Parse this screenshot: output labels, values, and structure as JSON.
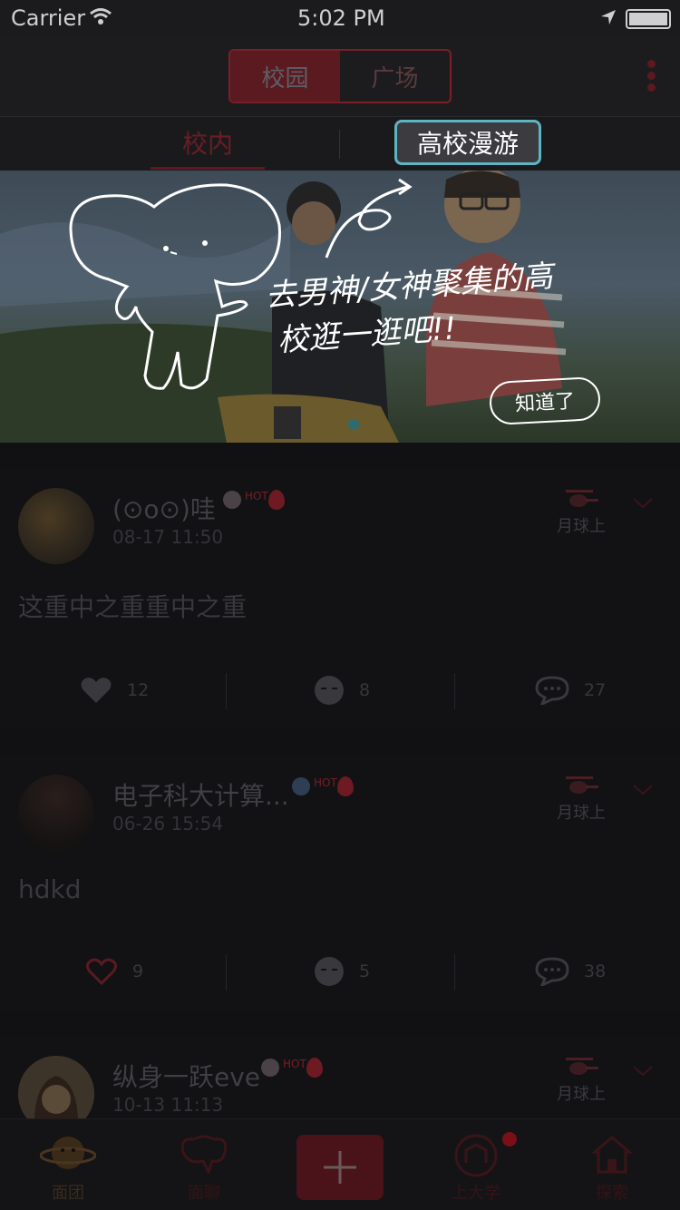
{
  "status_bar": {
    "carrier": "Carrier",
    "time": "5:02 PM"
  },
  "nav": {
    "segments": [
      "校园",
      "广场"
    ],
    "active_segment": 0
  },
  "subtabs": {
    "inner": "校内",
    "roam": "高校漫游"
  },
  "banner": {
    "line1": "去男神/女神聚集的高",
    "line2": "校逛一逛吧!!",
    "got_it": "知道了"
  },
  "posts": [
    {
      "name": "(⊙o⊙)哇",
      "badge_text": "HOT",
      "time": "08-17 11:50",
      "location": "月球上",
      "content": "这重中之重重中之重",
      "likes": "12",
      "meh": "8",
      "comments": "27"
    },
    {
      "name": "电子科大计算...",
      "badge_text": "HOT",
      "time": "06-26 15:54",
      "location": "月球上",
      "content": "hdkd",
      "likes": "9",
      "meh": "5",
      "comments": "38"
    },
    {
      "name": "纵身一跃eve",
      "badge_text": "HOT",
      "time": "10-13 11:13",
      "location": "月球上"
    }
  ],
  "tabbar": {
    "tab1": "面团",
    "tab2": "面聊",
    "tab4": "上大学",
    "tab5": "探索"
  },
  "colors": {
    "accent": "#c0303f",
    "highlight_border": "#5fb4c2"
  }
}
